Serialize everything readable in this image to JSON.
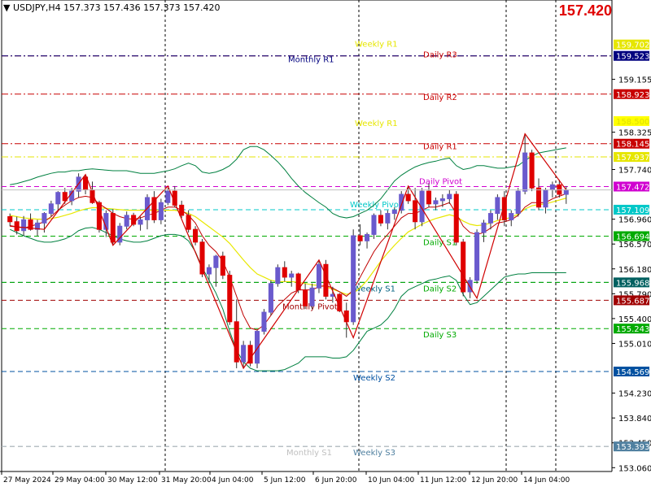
{
  "header": {
    "symbol": "USDJPY,H4",
    "ohlc": "157.373 157.436 157.373 157.420",
    "current_price": "157.420"
  },
  "chart_data": {
    "type": "candlestick",
    "symbol": "USDJPY",
    "timeframe": "H4",
    "ylim": [
      153.0,
      160.4
    ],
    "grid": false,
    "y_ticks": [
      "159.155",
      "158.325",
      "157.740",
      "156.960",
      "156.570",
      "156.180",
      "155.790",
      "155.400",
      "155.010",
      "154.230",
      "153.840",
      "153.450",
      "153.060"
    ],
    "x_ticks": [
      "27 May 2024",
      "29 May 04:00",
      "30 May 12:00",
      "31 May 20:00",
      "4 Jun 04:00",
      "5 Jun 12:00",
      "6 Jun 20:00",
      "10 Jun 04:00",
      "11 Jun 12:00",
      "12 Jun 20:00",
      "14 Jun 04:00"
    ],
    "session_separators": [
      "31 May 20:00",
      "6 Jun 20:00",
      "12 Jun 20:00",
      "14 Jun 04:00"
    ],
    "levels": [
      {
        "label": "Weekly R1",
        "value": 157.937,
        "color": "#e6e600",
        "style": "dashdot",
        "show_tag": true
      },
      {
        "label": "Daily R3",
        "value": 159.523,
        "color": "#b40000",
        "style": "dashdot",
        "show_tag": false
      },
      {
        "label": "Monthly R1",
        "value": 159.523,
        "color": "#00007f",
        "style": "dashdot",
        "show_tag": true
      },
      {
        "label": "Daily R2",
        "value": 158.923,
        "color": "#c80000",
        "style": "dashdot",
        "show_tag": true
      },
      {
        "label": "Daily R1",
        "value": 158.145,
        "color": "#c80000",
        "style": "dashdot",
        "show_tag": true
      },
      {
        "label": "Daily Pivot",
        "value": 157.472,
        "color": "#d000d0",
        "style": "dashed",
        "show_tag": true
      },
      {
        "label": "Weekly Pivot",
        "value": 157.109,
        "color": "#00c8c8",
        "style": "dashed",
        "show_tag": true
      },
      {
        "label": "Daily S1",
        "value": 156.694,
        "color": "#00aa00",
        "style": "dashed",
        "show_tag": true
      },
      {
        "label": "Weekly S1",
        "value": 155.968,
        "color": "#006060",
        "style": "dashed",
        "show_tag": true
      },
      {
        "label": "Daily S2",
        "value": 155.968,
        "color": "#00aa00",
        "style": "dashed",
        "show_tag": false
      },
      {
        "label": "Monthly Pivot",
        "value": 155.687,
        "color": "#a00000",
        "style": "dashed",
        "show_tag": true
      },
      {
        "label": "Daily S3",
        "value": 155.243,
        "color": "#00aa00",
        "style": "dashed",
        "show_tag": true
      },
      {
        "label": "Weekly S2",
        "value": 154.569,
        "color": "#0050a0",
        "style": "dashed",
        "show_tag": true
      },
      {
        "label": "Weekly S3",
        "value": 153.393,
        "color": "#5080a0",
        "style": "dashed",
        "show_tag": true
      },
      {
        "label": "Monthly S1",
        "value": 153.393,
        "color": "#c0c0c0",
        "style": "dashed",
        "show_tag": false
      }
    ],
    "tags_extra": [
      {
        "value": 159.702,
        "color": "#e6e600"
      },
      {
        "value": 158.5,
        "color": "#ffff00"
      }
    ],
    "level_texts": [
      {
        "text": "Weekly R1",
        "color": "#e6e600",
        "near": 159.702
      },
      {
        "text": "Daily R3",
        "color": "#c80000",
        "near": 159.523
      },
      {
        "text": "Monthly R1",
        "color": "#00007f",
        "near": 159.523
      },
      {
        "text": "Daily R2",
        "color": "#c80000",
        "near": 158.923
      },
      {
        "text": "Weekly R1",
        "color": "#e6e600",
        "near": 158.5
      },
      {
        "text": "Daily R1",
        "color": "#c80000",
        "near": 158.145
      },
      {
        "text": "Daily Pivot",
        "color": "#d000d0",
        "near": 157.472
      },
      {
        "text": "Weekly Pivot",
        "color": "#00c8c8",
        "near": 157.109
      },
      {
        "text": "Daily S1",
        "color": "#00aa00",
        "near": 156.694
      },
      {
        "text": "Weekly S1",
        "color": "#006080",
        "near": 155.968
      },
      {
        "text": "Daily S2",
        "color": "#00aa00",
        "near": 155.968
      },
      {
        "text": "Monthly Pivot",
        "color": "#a00000",
        "near": 155.687
      },
      {
        "text": "Daily S3",
        "color": "#00aa00",
        "near": 155.243
      },
      {
        "text": "Weekly S2",
        "color": "#0050a0",
        "near": 154.569
      },
      {
        "text": "Monthly S1",
        "color": "#c0c0c0",
        "near": 153.393
      },
      {
        "text": "Weekly S3",
        "color": "#5080a0",
        "near": 153.393
      }
    ],
    "candles": [
      [
        157.0,
        157.05,
        156.85,
        156.92
      ],
      [
        156.92,
        157.0,
        156.72,
        156.78
      ],
      [
        156.78,
        157.01,
        156.7,
        156.95
      ],
      [
        156.95,
        157.05,
        156.78,
        156.8
      ],
      [
        156.8,
        156.95,
        156.7,
        156.9
      ],
      [
        156.9,
        157.07,
        156.75,
        157.05
      ],
      [
        157.05,
        157.25,
        157.0,
        157.2
      ],
      [
        157.2,
        157.4,
        157.1,
        157.38
      ],
      [
        157.38,
        157.45,
        157.2,
        157.25
      ],
      [
        157.25,
        157.45,
        157.18,
        157.4
      ],
      [
        157.4,
        157.68,
        157.3,
        157.62
      ],
      [
        157.62,
        157.66,
        157.35,
        157.42
      ],
      [
        157.42,
        157.55,
        157.2,
        157.22
      ],
      [
        157.22,
        157.25,
        156.75,
        156.8
      ],
      [
        156.8,
        157.1,
        156.68,
        157.05
      ],
      [
        157.05,
        157.12,
        156.55,
        156.6
      ],
      [
        156.6,
        156.9,
        156.55,
        156.85
      ],
      [
        156.85,
        157.08,
        156.8,
        157.02
      ],
      [
        157.02,
        157.06,
        156.85,
        156.88
      ],
      [
        156.88,
        157.0,
        156.78,
        156.95
      ],
      [
        156.95,
        157.35,
        156.8,
        157.3
      ],
      [
        157.3,
        157.4,
        156.9,
        156.95
      ],
      [
        156.95,
        157.28,
        156.88,
        157.22
      ],
      [
        157.22,
        157.45,
        157.18,
        157.4
      ],
      [
        157.4,
        157.48,
        157.15,
        157.18
      ],
      [
        157.18,
        157.25,
        156.98,
        157.02
      ],
      [
        157.02,
        157.1,
        156.75,
        156.8
      ],
      [
        156.8,
        156.85,
        156.55,
        156.6
      ],
      [
        156.6,
        156.65,
        156.05,
        156.1
      ],
      [
        156.1,
        156.25,
        155.98,
        156.2
      ],
      [
        156.2,
        156.4,
        155.9,
        156.38
      ],
      [
        156.38,
        156.45,
        156.02,
        156.08
      ],
      [
        156.08,
        156.15,
        155.3,
        155.35
      ],
      [
        155.35,
        155.7,
        154.62,
        154.72
      ],
      [
        154.72,
        155.05,
        154.62,
        154.98
      ],
      [
        154.98,
        155.05,
        154.65,
        154.7
      ],
      [
        154.7,
        155.22,
        154.62,
        155.2
      ],
      [
        155.2,
        155.55,
        155.15,
        155.5
      ],
      [
        155.5,
        156.0,
        155.45,
        155.95
      ],
      [
        155.95,
        156.25,
        155.9,
        156.2
      ],
      [
        156.2,
        156.3,
        155.98,
        156.05
      ],
      [
        156.05,
        156.15,
        155.9,
        156.1
      ],
      [
        156.1,
        156.12,
        155.8,
        155.85
      ],
      [
        155.85,
        155.95,
        155.55,
        155.6
      ],
      [
        155.6,
        155.95,
        155.55,
        155.88
      ],
      [
        155.88,
        156.32,
        155.8,
        156.25
      ],
      [
        156.25,
        156.32,
        155.7,
        155.75
      ],
      [
        155.75,
        155.9,
        155.65,
        155.78
      ],
      [
        155.78,
        155.8,
        155.5,
        155.52
      ],
      [
        155.52,
        155.65,
        155.1,
        155.35
      ],
      [
        155.35,
        156.8,
        155.3,
        156.7
      ],
      [
        156.7,
        156.88,
        156.55,
        156.62
      ],
      [
        156.62,
        156.75,
        156.5,
        156.72
      ],
      [
        156.72,
        157.05,
        156.65,
        157.02
      ],
      [
        157.02,
        157.1,
        156.85,
        156.9
      ],
      [
        156.9,
        157.1,
        156.8,
        157.05
      ],
      [
        157.05,
        157.15,
        156.95,
        157.1
      ],
      [
        157.1,
        157.4,
        157.05,
        157.35
      ],
      [
        157.35,
        157.48,
        157.2,
        157.25
      ],
      [
        157.25,
        157.45,
        156.8,
        156.92
      ],
      [
        156.92,
        157.45,
        156.85,
        157.4
      ],
      [
        157.4,
        157.52,
        157.15,
        157.2
      ],
      [
        157.2,
        157.3,
        157.1,
        157.25
      ],
      [
        157.25,
        157.35,
        157.15,
        157.28
      ],
      [
        157.28,
        157.42,
        157.2,
        157.35
      ],
      [
        157.35,
        157.4,
        156.55,
        156.6
      ],
      [
        156.6,
        156.65,
        155.75,
        155.82
      ],
      [
        155.82,
        156.05,
        155.72,
        156.0
      ],
      [
        156.0,
        156.8,
        155.95,
        156.75
      ],
      [
        156.75,
        156.95,
        156.6,
        156.9
      ],
      [
        156.9,
        157.1,
        156.8,
        157.05
      ],
      [
        157.05,
        157.35,
        156.95,
        157.3
      ],
      [
        157.3,
        157.4,
        156.85,
        156.95
      ],
      [
        156.95,
        157.1,
        156.85,
        157.05
      ],
      [
        157.05,
        157.45,
        157.0,
        157.4
      ],
      [
        157.4,
        158.3,
        157.35,
        158.0
      ],
      [
        158.0,
        158.05,
        157.4,
        157.45
      ],
      [
        157.45,
        157.6,
        157.1,
        157.15
      ],
      [
        157.15,
        157.45,
        157.05,
        157.42
      ],
      [
        157.42,
        157.55,
        157.3,
        157.5
      ],
      [
        157.5,
        157.58,
        157.3,
        157.35
      ],
      [
        157.35,
        157.48,
        157.2,
        157.42
      ]
    ],
    "ma_fast": [
      156.86,
      156.84,
      156.82,
      156.85,
      156.88,
      156.92,
      157.0,
      157.1,
      157.18,
      157.25,
      157.3,
      157.32,
      157.3,
      157.2,
      157.13,
      157.05,
      157.0,
      156.97,
      156.96,
      156.98,
      157.02,
      157.05,
      157.1,
      157.15,
      157.15,
      157.1,
      157.02,
      156.9,
      156.7,
      156.55,
      156.45,
      156.3,
      156.05,
      155.75,
      155.45,
      155.25,
      155.22,
      155.3,
      155.45,
      155.6,
      155.7,
      155.8,
      155.85,
      155.85,
      155.85,
      155.9,
      155.92,
      155.88,
      155.82,
      155.75,
      155.85,
      156.05,
      156.25,
      156.45,
      156.6,
      156.72,
      156.85,
      156.98,
      157.05,
      157.05,
      157.1,
      157.15,
      157.15,
      157.18,
      157.22,
      157.05,
      156.85,
      156.75,
      156.72,
      156.75,
      156.82,
      156.9,
      156.92,
      156.95,
      157.02,
      157.15,
      157.22,
      157.22,
      157.22,
      157.28,
      157.32,
      157.36
    ],
    "ma_slow": [
      157.02,
      157.0,
      156.98,
      156.97,
      156.96,
      156.96,
      156.97,
      156.99,
      157.02,
      157.05,
      157.09,
      157.12,
      157.14,
      157.14,
      157.13,
      157.12,
      157.11,
      157.1,
      157.1,
      157.1,
      157.1,
      157.1,
      157.1,
      157.1,
      157.1,
      157.08,
      157.05,
      157.0,
      156.92,
      156.84,
      156.76,
      156.68,
      156.58,
      156.45,
      156.32,
      156.2,
      156.1,
      156.05,
      156.0,
      155.98,
      155.98,
      155.98,
      155.97,
      155.95,
      155.93,
      155.92,
      155.9,
      155.86,
      155.82,
      155.78,
      155.8,
      155.88,
      156.0,
      156.15,
      156.3,
      156.43,
      156.55,
      156.66,
      156.76,
      156.82,
      156.88,
      156.93,
      156.97,
      157.0,
      157.03,
      157.0,
      156.93,
      156.88,
      156.86,
      156.87,
      156.9,
      156.94,
      156.96,
      156.99,
      157.04,
      157.12,
      157.17,
      157.19,
      157.2,
      157.23,
      157.26,
      157.29
    ],
    "bb_upper": [
      157.5,
      157.52,
      157.55,
      157.58,
      157.62,
      157.65,
      157.68,
      157.7,
      157.7,
      157.72,
      157.72,
      157.74,
      157.75,
      157.74,
      157.73,
      157.72,
      157.72,
      157.72,
      157.7,
      157.68,
      157.68,
      157.68,
      157.7,
      157.72,
      157.75,
      157.8,
      157.84,
      157.8,
      157.7,
      157.68,
      157.7,
      157.74,
      157.8,
      157.9,
      158.05,
      158.1,
      158.1,
      158.05,
      157.96,
      157.86,
      157.74,
      157.6,
      157.48,
      157.38,
      157.3,
      157.22,
      157.15,
      157.05,
      157.0,
      156.98,
      157.0,
      157.05,
      157.1,
      157.18,
      157.28,
      157.42,
      157.56,
      157.65,
      157.72,
      157.78,
      157.82,
      157.85,
      157.87,
      157.9,
      157.92,
      157.8,
      157.74,
      157.76,
      157.8,
      157.8,
      157.78,
      157.76,
      157.76,
      157.78,
      157.8,
      157.88,
      157.95,
      158.0,
      158.02,
      158.04,
      158.06,
      158.08
    ],
    "bb_lower": [
      156.8,
      156.75,
      156.7,
      156.66,
      156.62,
      156.6,
      156.6,
      156.62,
      156.65,
      156.7,
      156.78,
      156.82,
      156.83,
      156.8,
      156.75,
      156.7,
      156.65,
      156.62,
      156.6,
      156.6,
      156.62,
      156.66,
      156.7,
      156.72,
      156.72,
      156.7,
      156.62,
      156.45,
      156.2,
      156.0,
      155.8,
      155.55,
      155.2,
      154.9,
      154.72,
      154.62,
      154.58,
      154.58,
      154.58,
      154.58,
      154.6,
      154.65,
      154.7,
      154.8,
      154.8,
      154.8,
      154.8,
      154.78,
      154.78,
      154.8,
      154.9,
      155.05,
      155.2,
      155.25,
      155.3,
      155.4,
      155.55,
      155.75,
      155.85,
      155.9,
      155.95,
      156.0,
      156.02,
      156.05,
      156.07,
      156.0,
      155.78,
      155.62,
      155.65,
      155.75,
      155.85,
      155.95,
      156.05,
      156.08,
      156.1,
      156.1,
      156.12,
      156.12,
      156.12,
      156.12,
      156.12,
      156.12
    ],
    "zigzag": [
      [
        0,
        156.85
      ],
      [
        5,
        156.8
      ],
      [
        11,
        157.66
      ],
      [
        15,
        156.55
      ],
      [
        23,
        157.48
      ],
      [
        34,
        154.62
      ],
      [
        45,
        156.32
      ],
      [
        50,
        155.1
      ],
      [
        58,
        157.48
      ],
      [
        68,
        155.72
      ],
      [
        75,
        158.3
      ],
      [
        81,
        157.42
      ]
    ]
  }
}
